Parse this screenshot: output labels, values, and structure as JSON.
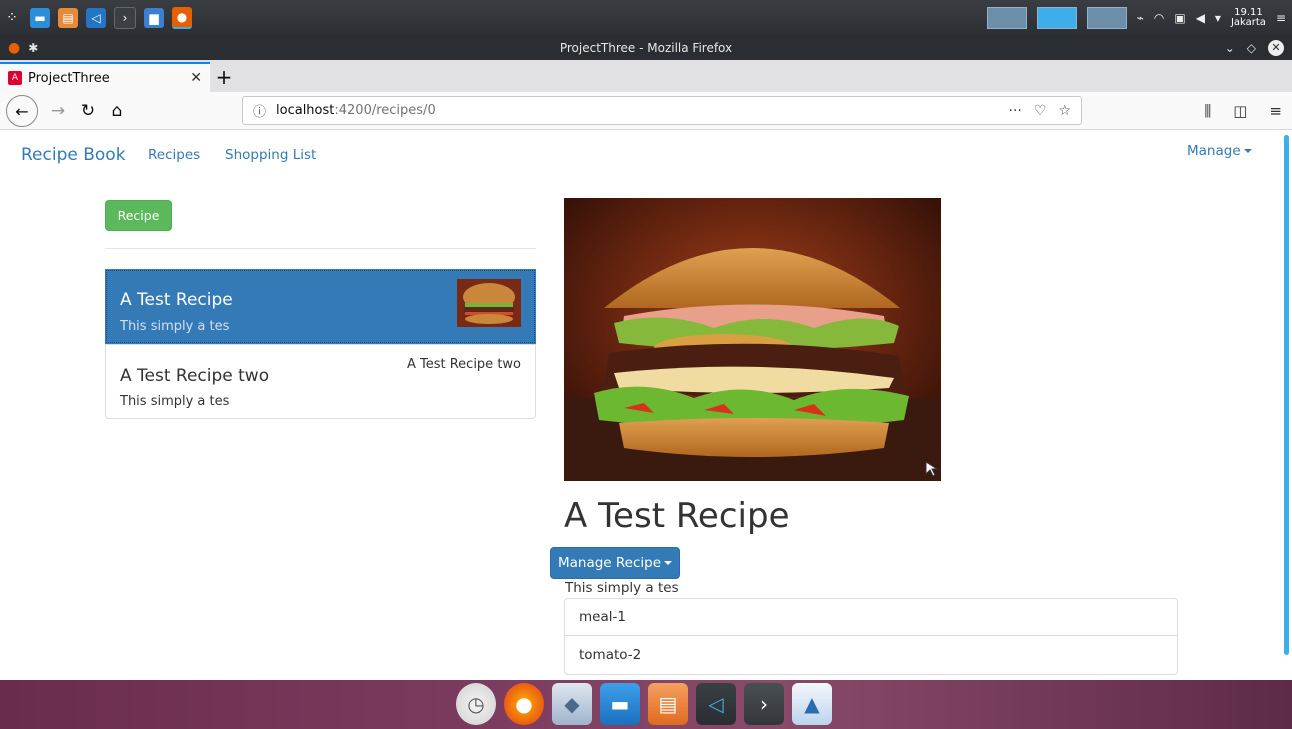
{
  "window": {
    "title": "ProjectThree - Mozilla Firefox"
  },
  "system": {
    "clock_time": "19.11",
    "clock_zone": "Jakarta"
  },
  "tabs": [
    {
      "label": "ProjectThree"
    }
  ],
  "url": {
    "host": "localhost",
    "path": ":4200/recipes/0"
  },
  "app": {
    "brand": "Recipe Book",
    "nav": {
      "recipes": "Recipes",
      "shopping_list": "Shopping List",
      "manage": "Manage"
    }
  },
  "sidebar": {
    "new_button": "Recipe",
    "recipes": [
      {
        "name": "A Test Recipe",
        "description": "This simply a tes",
        "image_alt": ""
      },
      {
        "name": "A Test Recipe two",
        "description": "This simply a tes",
        "image_alt": "A Test Recipe two"
      }
    ]
  },
  "detail": {
    "title": "A Test Recipe",
    "manage_button": "Manage Recipe",
    "description": "This simply a tes",
    "ingredients": [
      "meal-1",
      "tomato-2"
    ]
  },
  "colors": {
    "primary": "#337ab7",
    "success": "#5cb85c",
    "accent": "#3daee9"
  }
}
